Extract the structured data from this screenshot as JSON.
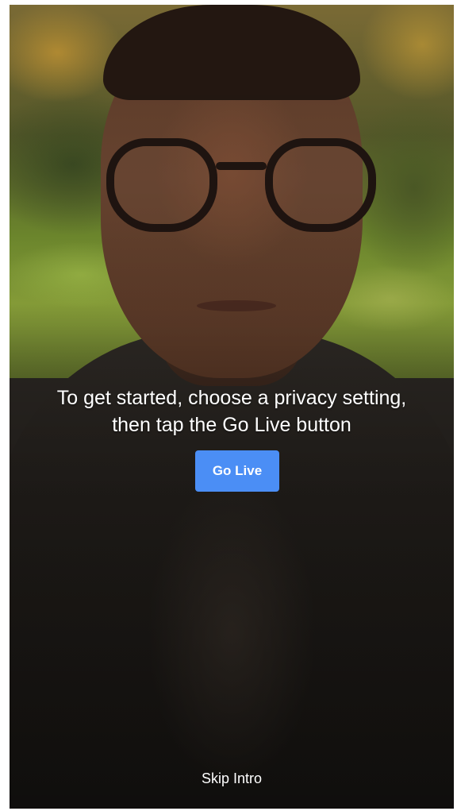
{
  "intro": {
    "instruction_line1": "To get started, choose a privacy setting,",
    "instruction_line2": "then tap the Go Live button",
    "go_live_label": "Go Live",
    "skip_label": "Skip Intro"
  },
  "colors": {
    "accent": "#4b8ef5",
    "text": "#ffffff"
  }
}
